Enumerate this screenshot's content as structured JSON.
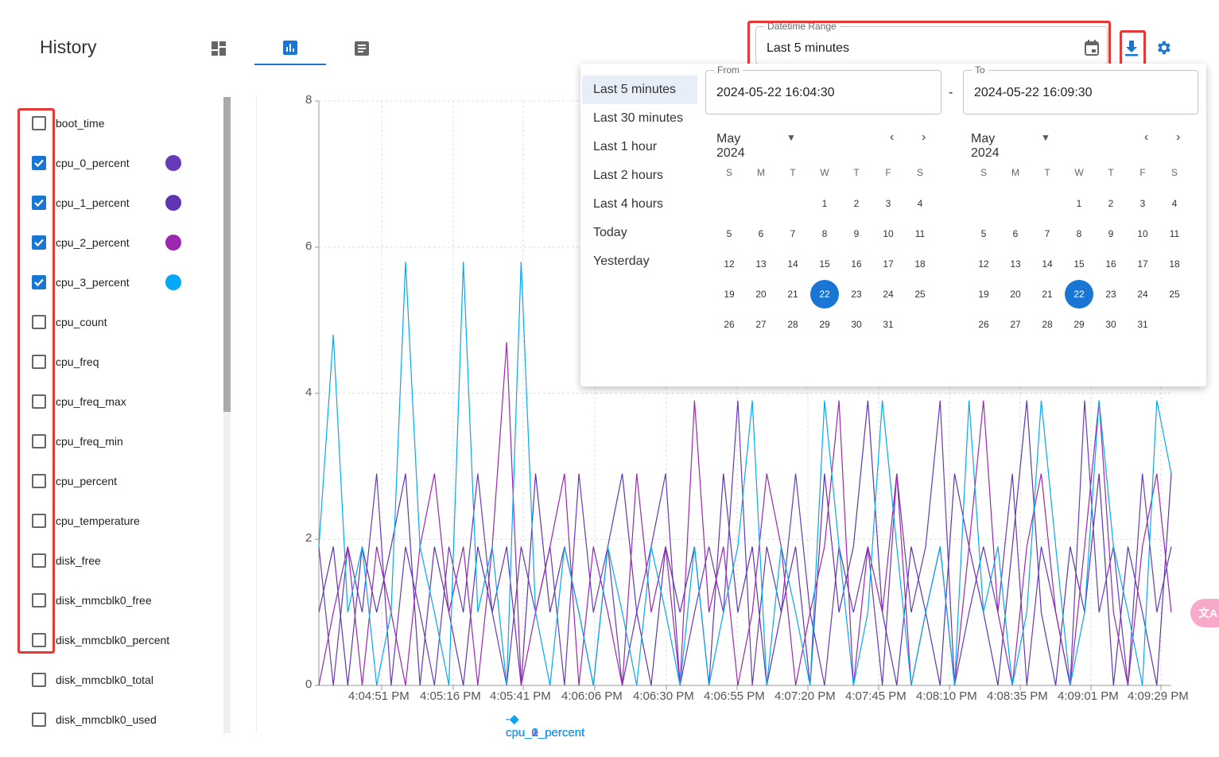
{
  "header": {
    "title": "History",
    "tabs": [
      {
        "icon": "dashboard-icon"
      },
      {
        "icon": "bar-chart-icon",
        "active": true
      },
      {
        "icon": "list-icon"
      }
    ]
  },
  "sidebar": {
    "items": [
      {
        "label": "boot_time",
        "checked": false
      },
      {
        "label": "cpu_0_percent",
        "checked": true,
        "color": "#673ab7"
      },
      {
        "label": "cpu_1_percent",
        "checked": true,
        "color": "#5e35b1"
      },
      {
        "label": "cpu_2_percent",
        "checked": true,
        "color": "#9c27b0"
      },
      {
        "label": "cpu_3_percent",
        "checked": true,
        "color": "#03a9f4"
      },
      {
        "label": "cpu_count",
        "checked": false
      },
      {
        "label": "cpu_freq",
        "checked": false
      },
      {
        "label": "cpu_freq_max",
        "checked": false
      },
      {
        "label": "cpu_freq_min",
        "checked": false
      },
      {
        "label": "cpu_percent",
        "checked": false
      },
      {
        "label": "cpu_temperature",
        "checked": false
      },
      {
        "label": "disk_free",
        "checked": false
      },
      {
        "label": "disk_mmcblk0_free",
        "checked": false
      },
      {
        "label": "disk_mmcblk0_percent",
        "checked": false
      },
      {
        "label": "disk_mmcblk0_total",
        "checked": false
      },
      {
        "label": "disk_mmcblk0_used",
        "checked": false
      }
    ]
  },
  "range": {
    "label": "Datetime Range",
    "value": "Last 5 minutes"
  },
  "picker": {
    "presets": [
      "Last 5 minutes",
      "Last 30 minutes",
      "Last 1 hour",
      "Last 2 hours",
      "Last 4 hours",
      "Today",
      "Yesterday"
    ],
    "from_label": "From",
    "from": "2024-05-22 16:04:30",
    "sep": "-",
    "to_label": "To",
    "to": "2024-05-22 16:09:30",
    "month": "May 2024",
    "weekdays": [
      "S",
      "M",
      "T",
      "W",
      "T",
      "F",
      "S"
    ],
    "first_weekday": 3,
    "days": 31,
    "selected": 22
  },
  "chart_data": {
    "type": "line",
    "ylim": [
      0,
      8
    ],
    "yticks": [
      "0",
      "2",
      "4",
      "6",
      "8"
    ],
    "xticks": [
      "4:04:51 PM",
      "4:05:16 PM",
      "4:05:41 PM",
      "4:06:06 PM",
      "4:06:30 PM",
      "4:06:55 PM",
      "4:07:20 PM",
      "4:07:45 PM",
      "4:08:10 PM",
      "4:08:35 PM",
      "4:09:01 PM",
      "4:09:29 PM"
    ],
    "series": [
      {
        "name": "cpu_0_percent",
        "color": "#673ab7",
        "values": [
          1.9,
          0,
          1.9,
          1,
          2.9,
          0,
          1.9,
          1,
          0,
          1.9,
          1,
          2.9,
          1,
          0,
          1.9,
          1,
          1.9,
          0,
          2.9,
          1,
          1.9,
          0,
          1,
          1.9,
          2.9,
          0,
          1,
          1.9,
          1,
          3.9,
          0,
          1.9,
          1,
          2.9,
          1,
          0,
          1.9,
          1,
          1.9,
          0,
          2.9,
          1,
          1.9,
          3.9,
          0,
          1,
          1.9,
          1,
          2.9,
          0,
          1.9,
          1,
          0,
          3.9,
          1,
          1.9,
          0,
          2.9,
          1,
          1.9
        ]
      },
      {
        "name": "cpu_1_percent",
        "color": "#5e35b1",
        "values": [
          1,
          1.9,
          0,
          1.9,
          1,
          1.9,
          2.9,
          0,
          1.9,
          1,
          0,
          1.9,
          1,
          1.9,
          0,
          2.9,
          1,
          1.9,
          1,
          0,
          1.9,
          2.9,
          1,
          0,
          1.9,
          1,
          1.9,
          0,
          2.9,
          1,
          1.9,
          0,
          1,
          1.9,
          0,
          2.9,
          1,
          1.9,
          3.9,
          1,
          0,
          1.9,
          1,
          0,
          2.9,
          1.9,
          1,
          0,
          1.9,
          3.9,
          1,
          0,
          1.9,
          1,
          2.9,
          0,
          1.9,
          1,
          0,
          2.9
        ]
      },
      {
        "name": "cpu_2_percent",
        "color": "#9c27b0",
        "values": [
          0,
          1,
          1.9,
          0,
          1.9,
          1,
          0,
          1.9,
          2.9,
          1,
          1.9,
          0,
          1.9,
          4.7,
          0,
          1,
          1.9,
          2.9,
          0,
          1.9,
          1,
          0,
          2.9,
          1,
          1.9,
          0,
          3.9,
          1,
          1.9,
          0,
          1,
          2.9,
          1.9,
          0,
          1,
          1.9,
          3.9,
          0,
          1.9,
          1,
          2.9,
          0,
          1,
          1.9,
          0,
          1.9,
          3.9,
          1,
          0,
          1.9,
          2.9,
          1,
          0,
          1.9,
          3.9,
          1,
          0,
          1.9,
          2.9,
          1
        ]
      },
      {
        "name": "cpu_3_percent",
        "color": "#03a9f4",
        "values": [
          1.9,
          4.8,
          1,
          1.9,
          0,
          1,
          5.8,
          1.9,
          1,
          0,
          5.8,
          1,
          1.9,
          0,
          5.8,
          1,
          0,
          1.9,
          1,
          0,
          1.9,
          1,
          0,
          1.9,
          1,
          0,
          1.9,
          0,
          1,
          1.9,
          3.9,
          0,
          1.9,
          1,
          0,
          3.9,
          1.9,
          0,
          1,
          3.9,
          1.9,
          0,
          1,
          1.9,
          0,
          3.9,
          1,
          1.9,
          0,
          1,
          3.9,
          1.9,
          0,
          1,
          3.9,
          1.9,
          1,
          0,
          3.9,
          2.9
        ]
      }
    ]
  },
  "floating": {
    "icon": "translate-icon"
  }
}
